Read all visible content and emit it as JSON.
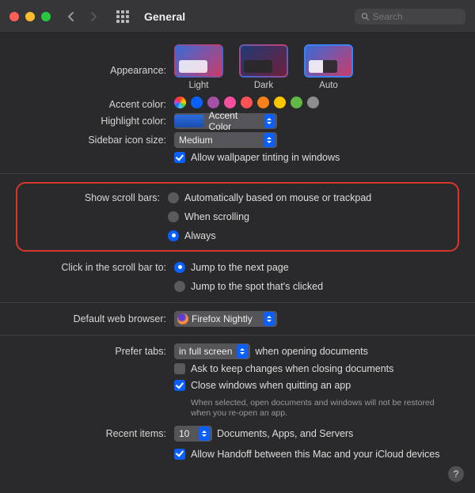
{
  "window": {
    "title": "General"
  },
  "search": {
    "placeholder": "Search"
  },
  "labels": {
    "appearance": "Appearance:",
    "accent": "Accent color:",
    "highlight": "Highlight color:",
    "sidebar": "Sidebar icon size:",
    "scrollbars": "Show scroll bars:",
    "clickbar": "Click in the scroll bar to:",
    "browser": "Default web browser:",
    "prefertabs": "Prefer tabs:",
    "recent": "Recent items:"
  },
  "appearance": {
    "options": [
      "Light",
      "Dark",
      "Auto"
    ],
    "selected": "Auto"
  },
  "accent_colors": [
    "multi",
    "#0a60ff",
    "#a550a7",
    "#f74f9e",
    "#ff5257",
    "#f7821b",
    "#ffc600",
    "#62ba46",
    "#8c8c91"
  ],
  "highlight": {
    "label": "Accent Color"
  },
  "sidebar_size": {
    "value": "Medium"
  },
  "wallpaper_tint": {
    "label": "Allow wallpaper tinting in windows",
    "checked": true
  },
  "scroll_bars": {
    "options": [
      "Automatically based on mouse or trackpad",
      "When scrolling",
      "Always"
    ],
    "selected": 2
  },
  "click_bar": {
    "options": [
      "Jump to the next page",
      "Jump to the spot that's clicked"
    ],
    "selected": 0
  },
  "browser": {
    "value": "Firefox Nightly"
  },
  "prefer_tabs": {
    "value": "in full screen",
    "suffix": "when opening documents"
  },
  "ask_keep_changes": {
    "label": "Ask to keep changes when closing documents",
    "checked": false
  },
  "close_windows": {
    "label": "Close windows when quitting an app",
    "sub": "When selected, open documents and windows will not be restored when you re-open an app.",
    "checked": true
  },
  "recent_items": {
    "value": "10",
    "suffix": "Documents, Apps, and Servers"
  },
  "handoff": {
    "label": "Allow Handoff between this Mac and your iCloud devices",
    "checked": true
  }
}
